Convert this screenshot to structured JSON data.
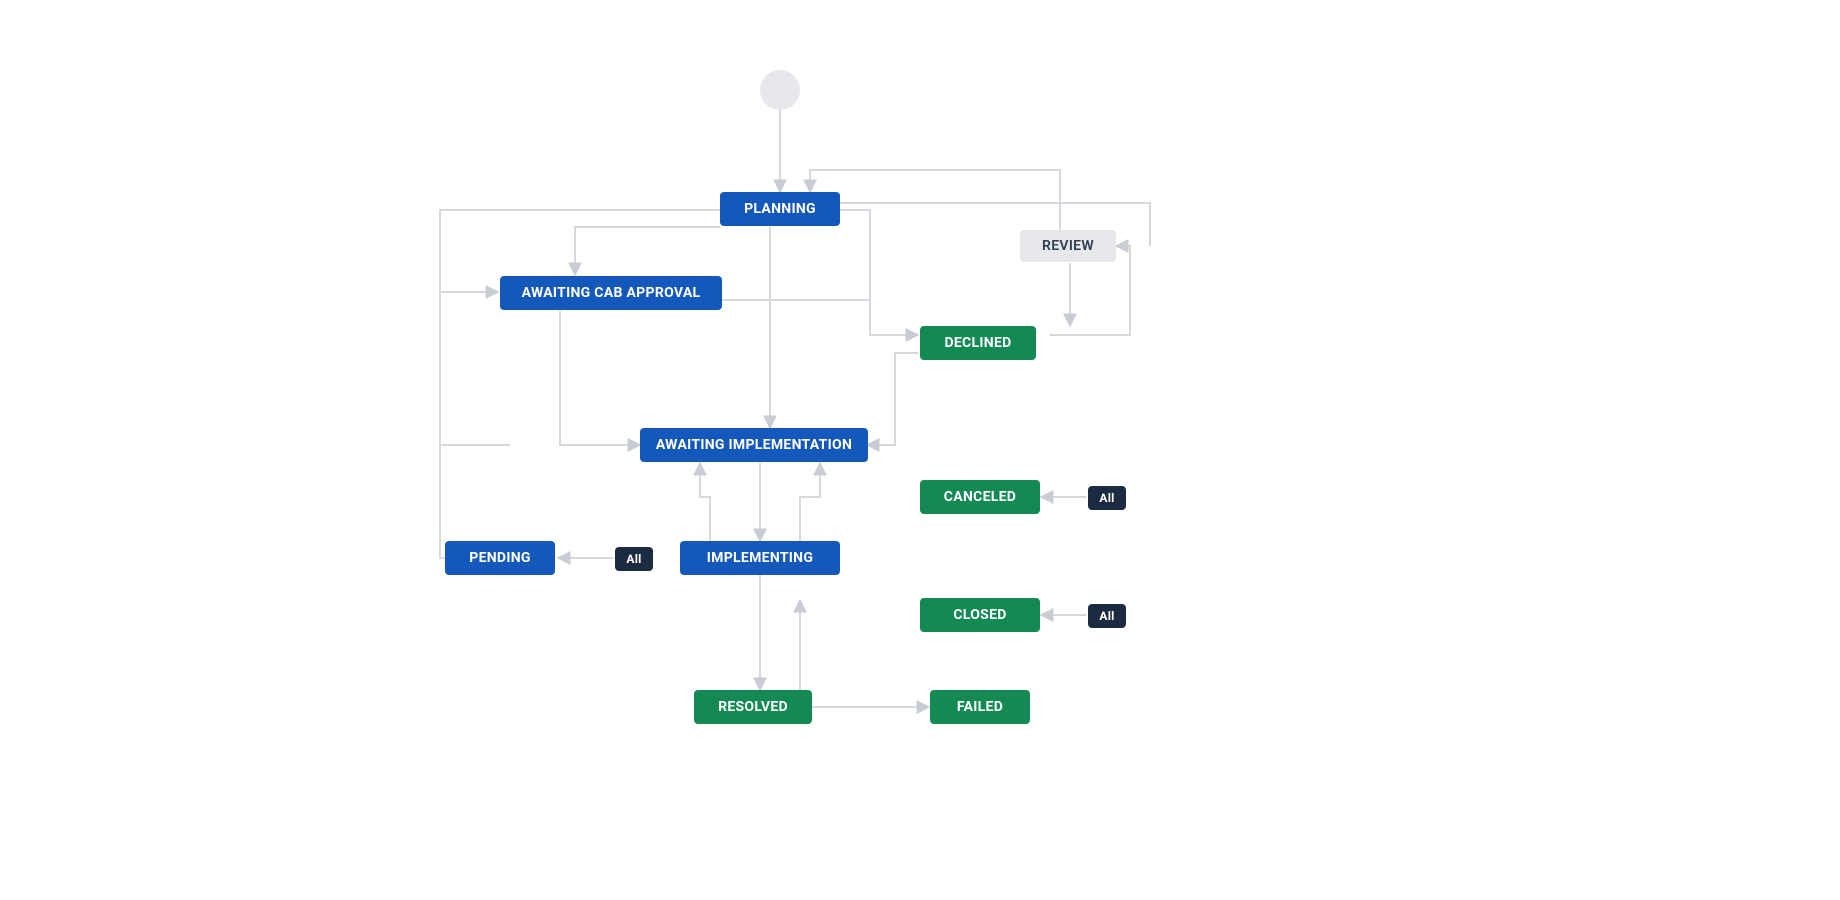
{
  "colors": {
    "blue": "#1558BC",
    "green": "#138A53",
    "gray": "#E6E8EC",
    "dark": "#1C2B41",
    "edge": "#D6D9DE",
    "edgeArrow": "#C9CDD3"
  },
  "nodes": {
    "planning": "PLANNING",
    "review": "REVIEW",
    "awaiting_cab": "AWAITING CAB APPROVAL",
    "declined": "DECLINED",
    "awaiting_impl": "AWAITING IMPLEMENTATION",
    "canceled": "CANCELED",
    "pending": "PENDING",
    "implementing": "IMPLEMENTING",
    "closed": "CLOSED",
    "resolved": "RESOLVED",
    "failed": "FAILED",
    "all1": "All",
    "all2": "All",
    "all3": "All"
  }
}
